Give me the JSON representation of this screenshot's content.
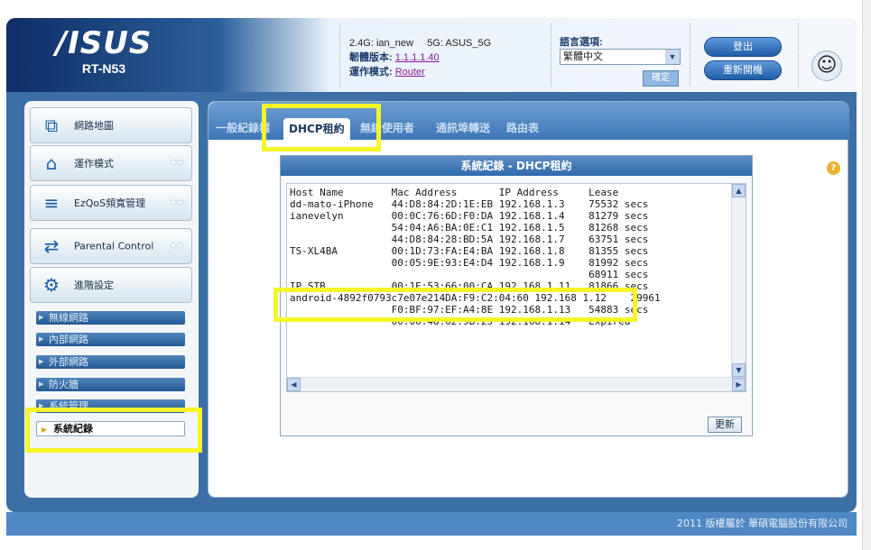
{
  "header": {
    "brand": "/ISUS",
    "model": "RT-N53",
    "ssid_label_24": "2.4G:",
    "ssid_24": "ian_new",
    "ssid_label_5": "5G:",
    "ssid_5": "ASUS_5G",
    "firmware_label": "韌體版本:",
    "firmware_value": "1.1.1.1.40",
    "mode_label": "運作模式:",
    "mode_value": "Router",
    "lang_label": "語言選項:",
    "lang_value": "繁體中文",
    "lang_apply": "確定",
    "logout": "登出",
    "reboot": "重新開機"
  },
  "sidebar": {
    "nav": [
      {
        "label": "網路地圖"
      },
      {
        "label": "運作模式"
      },
      {
        "label": "EzQoS頻寬管理"
      },
      {
        "label": "Parental Control"
      },
      {
        "label": "進階設定"
      }
    ],
    "sub": [
      {
        "label": "無線網路"
      },
      {
        "label": "內部網路"
      },
      {
        "label": "外部網路"
      },
      {
        "label": "防火牆"
      },
      {
        "label": "系統管理"
      }
    ],
    "active": "系統紀錄"
  },
  "tabs": [
    {
      "label": "一般紀錄檔"
    },
    {
      "label": "DHCP租約"
    },
    {
      "label": "無線使用者"
    },
    {
      "label": "通訊埠轉送"
    },
    {
      "label": "路由表"
    }
  ],
  "log": {
    "title": "系統紀錄 - DHCP租約",
    "columns": [
      "Host Name",
      "Mac Address",
      "IP Address",
      "Lease"
    ],
    "rows": [
      [
        "dd-mato-iPhone",
        "44:D8:84:2D:1E:EB",
        "192.168.1.3",
        "75532 secs"
      ],
      [
        "ianevelyn",
        "00:0C:76:6D:F0:DA",
        "192.168.1.4",
        "81279 secs"
      ],
      [
        "",
        "54:04:A6:BA:0E:C1",
        "192.168.1.5",
        "81268 secs"
      ],
      [
        "",
        "44:D8:84:28:BD:5A",
        "192.168.1.7",
        "63751 secs"
      ],
      [
        "TS-XL4BA",
        "00:1D:73:FA:E4:BA",
        "192.168.1.8",
        "81355 secs"
      ],
      [
        "",
        "00:05:9E:93:E4:D4",
        "192.168.1.9",
        "81992 secs"
      ],
      [
        "",
        "",
        "",
        "68911 secs"
      ],
      [
        "IP_STB",
        "00:1E:53:66:00:CA",
        "192.168.1.11",
        "81866 secs"
      ],
      [
        "android-4892f0793c7e07e214",
        "DA:F9:C2:04:60",
        "192.168",
        "1.12    29961"
      ],
      [
        "",
        "F0:BF:97:EF:A4:8E",
        "192.168.1.13",
        "54883 secs"
      ],
      [
        "",
        "00:00:48:62:9B:25",
        "192.168.1.14",
        "Expired"
      ]
    ],
    "refresh": "更新"
  },
  "help_glyph": "?",
  "footer": "2011 版權屬於 華碩電腦股份有限公司",
  "colors": {
    "highlight": "#f5f52a",
    "accent": "#2f6aab"
  }
}
